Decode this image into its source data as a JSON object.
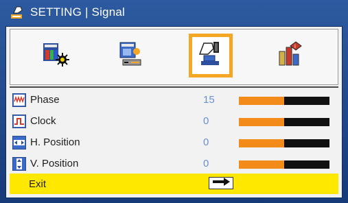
{
  "window": {
    "title": "SETTING | Signal"
  },
  "tabs": [
    {
      "name": "image",
      "icon": "image-settings-icon",
      "selected": false
    },
    {
      "name": "display",
      "icon": "display-settings-icon",
      "selected": false
    },
    {
      "name": "setting",
      "icon": "setting-hand-icon",
      "selected": true
    },
    {
      "name": "options",
      "icon": "options-info-icon",
      "selected": false
    }
  ],
  "rows": [
    {
      "label": "Phase",
      "value": "15",
      "level": 0.5,
      "icon": "phase-icon"
    },
    {
      "label": "Clock",
      "value": "0",
      "level": 0.5,
      "icon": "clock-icon"
    },
    {
      "label": "H. Position",
      "value": "0",
      "level": 0.5,
      "icon": "h-position-icon"
    },
    {
      "label": "V. Position",
      "value": "0",
      "level": 0.5,
      "icon": "v-position-icon"
    }
  ],
  "exit": {
    "label": "Exit",
    "icon": "right-arrow-icon"
  },
  "colors": {
    "accent": "#f5a623",
    "bar_fill": "#f28b1a",
    "exit_highlight": "#ffe800",
    "title_bg": "#2d5aa0"
  }
}
